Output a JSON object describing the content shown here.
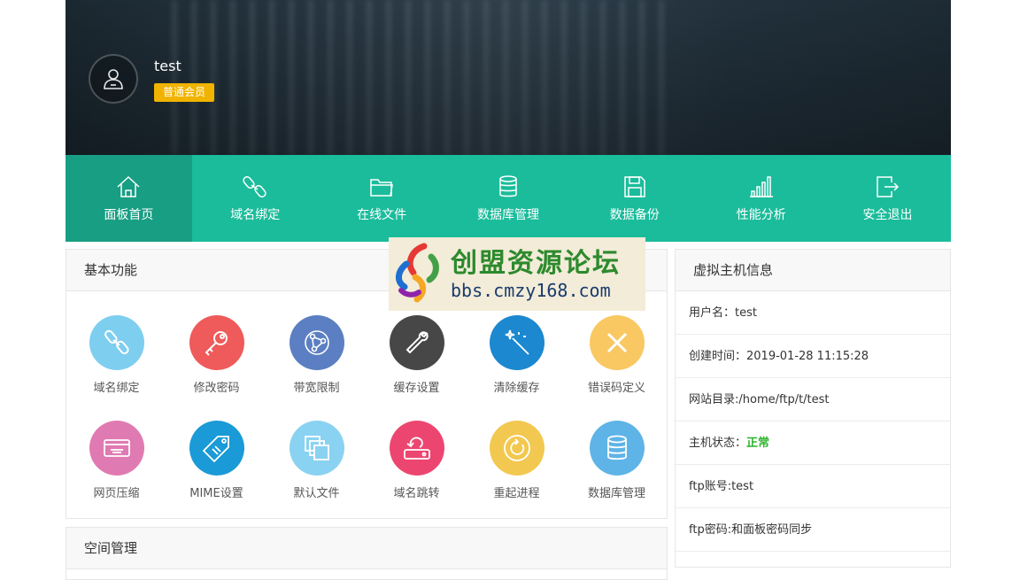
{
  "user": {
    "name": "test",
    "level": "普通会员"
  },
  "nav": [
    {
      "label": "面板首页",
      "icon": "home-icon"
    },
    {
      "label": "域名绑定",
      "icon": "link-icon"
    },
    {
      "label": "在线文件",
      "icon": "folder-icon"
    },
    {
      "label": "数据库管理",
      "icon": "database-icon"
    },
    {
      "label": "数据备份",
      "icon": "save-icon"
    },
    {
      "label": "性能分析",
      "icon": "bar-chart-icon"
    },
    {
      "label": "安全退出",
      "icon": "logout-icon"
    }
  ],
  "basic": {
    "title": "基本功能",
    "items": [
      {
        "label": "域名绑定",
        "icon": "link-icon",
        "color": "#7ecef0"
      },
      {
        "label": "修改密码",
        "icon": "key-icon",
        "color": "#ef5a5a"
      },
      {
        "label": "带宽限制",
        "icon": "network-icon",
        "color": "#5b7fc2"
      },
      {
        "label": "缓存设置",
        "icon": "wrench-icon",
        "color": "#474747"
      },
      {
        "label": "清除缓存",
        "icon": "magic-wand-icon",
        "color": "#1b88d0"
      },
      {
        "label": "错误码定义",
        "icon": "close-icon",
        "color": "#f9c862"
      },
      {
        "label": "网页压缩",
        "icon": "card-icon",
        "color": "#e07ab2"
      },
      {
        "label": "MIME设置",
        "icon": "tag-icon",
        "color": "#1a9ad6"
      },
      {
        "label": "默认文件",
        "icon": "files-icon",
        "color": "#8ad2f2"
      },
      {
        "label": "域名跳转",
        "icon": "redirect-icon",
        "color": "#ec4670"
      },
      {
        "label": "重起进程",
        "icon": "restart-icon",
        "color": "#f2c850"
      },
      {
        "label": "数据库管理",
        "icon": "database-icon",
        "color": "#5eb4e6"
      }
    ]
  },
  "space": {
    "title": "空间管理"
  },
  "host": {
    "title": "虚拟主机信息",
    "username": "用户名：test",
    "created": "创建时间：2019-01-28 11:15:28",
    "webroot": "网站目录:/home/ftp/t/test",
    "status_label": "主机状态：",
    "status_value": "正常",
    "ftp_account": "ftp账号:test",
    "ftp_password": "ftp密码:和面板密码同步"
  },
  "watermark": {
    "name": "创盟资源论坛",
    "url": "bbs.cmzy168.com"
  }
}
